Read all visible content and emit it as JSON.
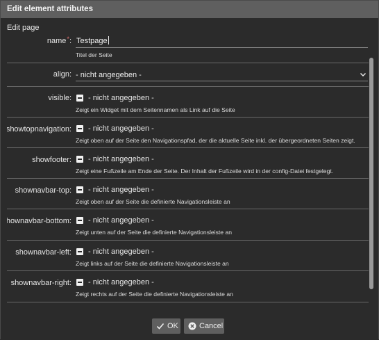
{
  "dialog": {
    "title": "Edit element attributes",
    "section": "Edit page"
  },
  "fields": {
    "name": {
      "label": "name",
      "required_mark": "*",
      "colon": ":",
      "value": "Testpage",
      "desc": "Titel der Seite"
    },
    "align": {
      "label": "align:",
      "value": "- nicht angegeben -"
    },
    "visible": {
      "label": "visible:",
      "value": "- nicht angegeben -",
      "desc": "Zeigt ein Widget mit dem Seitennamen als Link auf die Seite"
    },
    "showtopnavigation": {
      "label": "showtopnavigation:",
      "value": "- nicht angegeben -",
      "desc": "Zeigt oben auf der Seite den Navigationspfad, der die aktuelle Seite inkl. der übergeordneten Seiten zeigt."
    },
    "showfooter": {
      "label": "showfooter:",
      "value": "- nicht angegeben -",
      "desc": "Zeigt eine Fußzeile am Ende der Seite. Der Inhalt der Fußzeile wird in der config-Datei festgelegt."
    },
    "shownavbar_top": {
      "label": "shownavbar-top:",
      "value": "- nicht angegeben -",
      "desc": "Zeigt oben auf der Seite die definierte Navigationsleiste an"
    },
    "shownavbar_bottom": {
      "label": "shownavbar-bottom:",
      "value": "- nicht angegeben -",
      "desc": "Zeigt unten auf der Seite die definierte Navigationsleiste an"
    },
    "shownavbar_left": {
      "label": "shownavbar-left:",
      "value": "- nicht angegeben -",
      "desc": "Zeigt links auf der Seite die definierte Navigationsleiste an"
    },
    "shownavbar_right": {
      "label": "shownavbar-right:",
      "value": "- nicht angegeben -",
      "desc": "Zeigt rechts auf der Seite die definierte Navigationsleiste an"
    }
  },
  "buttons": {
    "ok": "OK",
    "cancel": "Cancel"
  },
  "icons": {
    "ok": "checkmark-icon",
    "cancel": "cancel-circle-icon",
    "select": "chevron-down-icon"
  }
}
